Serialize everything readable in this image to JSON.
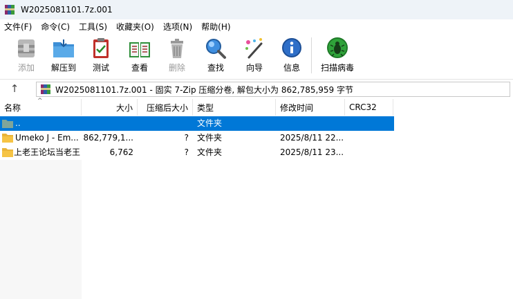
{
  "window": {
    "title": "W2025081101.7z.001"
  },
  "menu": [
    {
      "label": "文件(F)"
    },
    {
      "label": "命令(C)"
    },
    {
      "label": "工具(S)"
    },
    {
      "label": "收藏夹(O)"
    },
    {
      "label": "选项(N)"
    },
    {
      "label": "帮助(H)"
    }
  ],
  "toolbar": {
    "add": "添加",
    "extract": "解压到",
    "test": "测试",
    "view": "查看",
    "delete": "删除",
    "find": "查找",
    "wizard": "向导",
    "info": "信息",
    "scan": "扫描病毒"
  },
  "address": {
    "text": "W2025081101.7z.001 - 固实 7-Zip 压缩分卷, 解包大小为 862,785,959 字节",
    "up": "↑"
  },
  "columns": {
    "name": "名称",
    "size": "大小",
    "packed": "压缩后大小",
    "type": "类型",
    "modified": "修改时间",
    "crc": "CRC32"
  },
  "rows": [
    {
      "name": "..",
      "size": "",
      "packed": "",
      "type": "文件夹",
      "modified": "",
      "crc": ""
    },
    {
      "name": "Umeko J - Em...",
      "size": "862,779,1...",
      "packed": "?",
      "type": "文件夹",
      "modified": "2025/8/11 22...",
      "crc": ""
    },
    {
      "name": "上老王论坛当老王",
      "size": "6,762",
      "packed": "?",
      "type": "文件夹",
      "modified": "2025/8/11 23...",
      "crc": ""
    }
  ],
  "colors": {
    "selection": "#0078d7",
    "folder": "#f6c445",
    "scan_green": "#2fa33a"
  }
}
